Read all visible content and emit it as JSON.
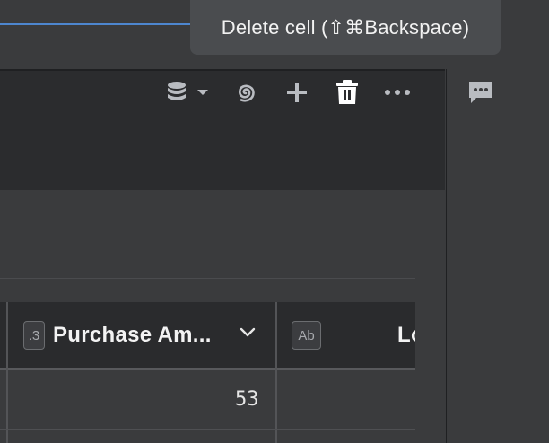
{
  "tooltip": {
    "text": "Delete cell (⇧⌘Backspace)"
  },
  "toolbar": {
    "icons": [
      "database-icon",
      "chevron-down-icon",
      "spiral-icon",
      "plus-icon",
      "trash-icon",
      "more-icon"
    ]
  },
  "sidebar": {
    "icons": [
      "comment-icon"
    ]
  },
  "table": {
    "columns": [
      {
        "type_badge": ".3",
        "label": "Purchase Am...",
        "icon": "chevron-down-icon"
      },
      {
        "type_badge": "Ab",
        "label": "Lo"
      }
    ],
    "rows": [
      {
        "purchase_amount": "53"
      }
    ]
  },
  "colors": {
    "accent": "#4d86cf",
    "background": "#3a3b3d",
    "cell_header": "#2b2c2e",
    "table_header": "#2a2b2d"
  }
}
